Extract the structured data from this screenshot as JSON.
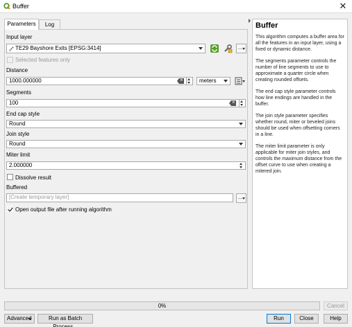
{
  "window": {
    "title": "Buffer",
    "close_icon": "close-icon",
    "app_icon": "qgis-icon"
  },
  "tabs": [
    {
      "label": "Parameters"
    },
    {
      "label": "Log"
    }
  ],
  "params": {
    "input_layer": {
      "label": "Input layer",
      "value": "TE29 Bayshore Exits [EPSG:3414]"
    },
    "selected_only": {
      "label": "Selected features only",
      "checked": false,
      "enabled": false
    },
    "distance": {
      "label": "Distance",
      "value": "1000.000000",
      "unit": "meters"
    },
    "segments": {
      "label": "Segments",
      "value": "100"
    },
    "end_cap": {
      "label": "End cap style",
      "value": "Round"
    },
    "join_style": {
      "label": "Join style",
      "value": "Round"
    },
    "miter_limit": {
      "label": "Miter limit",
      "value": "2.000000"
    },
    "dissolve": {
      "label": "Dissolve result",
      "checked": false
    },
    "buffered": {
      "label": "Buffered",
      "placeholder": "[Create temporary layer]"
    },
    "open_output": {
      "label": "Open output file after running algorithm",
      "checked": true
    }
  },
  "help": {
    "title": "Buffer",
    "paragraphs": [
      "This algorithm computes a buffer area for all the features in an input layer, using a fixed or dynamic distance.",
      "The segments parameter controls the number of line segments to use to approximate a quarter circle when creating rounded offsets.",
      "The end cap style parameter controls how line endings are handled in the buffer.",
      "The join style parameter specifies whether round, miter or beveled joins should be used when offsetting corners in a line.",
      "The miter limit parameter is only applicable for miter join styles, and controls the maximum distance from the offset curve to use when creating a mitered join."
    ]
  },
  "progress": {
    "value": 0,
    "text": "0%"
  },
  "buttons": {
    "cancel": "Cancel",
    "advanced": "Advanced",
    "batch": "Run as Batch Process...",
    "run": "Run",
    "close": "Close",
    "help": "Help"
  }
}
